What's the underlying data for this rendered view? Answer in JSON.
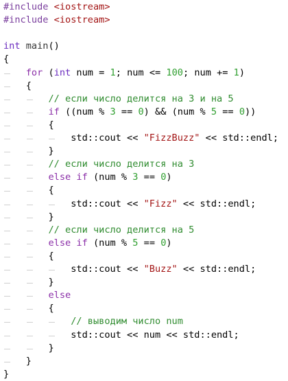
{
  "editor": {
    "lines": [
      [
        [
          "pre",
          "#include"
        ],
        [
          "op",
          " "
        ],
        [
          "inc",
          "<iostream>"
        ]
      ],
      [
        [
          "pre",
          "#include"
        ],
        [
          "op",
          " "
        ],
        [
          "inc",
          "<iostream>"
        ]
      ],
      [],
      [
        [
          "kw2",
          "int"
        ],
        [
          "op",
          " "
        ],
        [
          "fn",
          "main"
        ],
        [
          "op",
          "()"
        ]
      ],
      [
        [
          "op",
          "{"
        ]
      ],
      [
        [
          "op",
          "    "
        ],
        [
          "kw",
          "for"
        ],
        [
          "op",
          " ("
        ],
        [
          "kw2",
          "int"
        ],
        [
          "op",
          " num = "
        ],
        [
          "num",
          "1"
        ],
        [
          "op",
          "; num <= "
        ],
        [
          "num",
          "100"
        ],
        [
          "op",
          "; num += "
        ],
        [
          "num",
          "1"
        ],
        [
          "op",
          ")"
        ]
      ],
      [
        [
          "op",
          "    {"
        ]
      ],
      [
        [
          "op",
          "        "
        ],
        [
          "cm",
          "// если число делится на 3 и на 5"
        ]
      ],
      [
        [
          "op",
          "        "
        ],
        [
          "kw",
          "if"
        ],
        [
          "op",
          " ((num % "
        ],
        [
          "num",
          "3"
        ],
        [
          "op",
          " == "
        ],
        [
          "num",
          "0"
        ],
        [
          "op",
          ") && (num % "
        ],
        [
          "num",
          "5"
        ],
        [
          "op",
          " == "
        ],
        [
          "num",
          "0"
        ],
        [
          "op",
          "))"
        ]
      ],
      [
        [
          "op",
          "        {"
        ]
      ],
      [
        [
          "op",
          "            std::cout << "
        ],
        [
          "str",
          "\"FizzBuzz\""
        ],
        [
          "op",
          " << std::endl;"
        ]
      ],
      [
        [
          "op",
          "        }"
        ]
      ],
      [
        [
          "op",
          "        "
        ],
        [
          "cm",
          "// если число делится на 3"
        ]
      ],
      [
        [
          "op",
          "        "
        ],
        [
          "kw",
          "else"
        ],
        [
          "op",
          " "
        ],
        [
          "kw",
          "if"
        ],
        [
          "op",
          " (num % "
        ],
        [
          "num",
          "3"
        ],
        [
          "op",
          " == "
        ],
        [
          "num",
          "0"
        ],
        [
          "op",
          ")"
        ]
      ],
      [
        [
          "op",
          "        {"
        ]
      ],
      [
        [
          "op",
          "            std::cout << "
        ],
        [
          "str",
          "\"Fizz\""
        ],
        [
          "op",
          " << std::endl;"
        ]
      ],
      [
        [
          "op",
          "        }"
        ]
      ],
      [
        [
          "op",
          "        "
        ],
        [
          "cm",
          "// если число делится на 5"
        ]
      ],
      [
        [
          "op",
          "        "
        ],
        [
          "kw",
          "else"
        ],
        [
          "op",
          " "
        ],
        [
          "kw",
          "if"
        ],
        [
          "op",
          " (num % "
        ],
        [
          "num",
          "5"
        ],
        [
          "op",
          " == "
        ],
        [
          "num",
          "0"
        ],
        [
          "op",
          ")"
        ]
      ],
      [
        [
          "op",
          "        {"
        ]
      ],
      [
        [
          "op",
          "            std::cout << "
        ],
        [
          "str",
          "\"Buzz\""
        ],
        [
          "op",
          " << std::endl;"
        ]
      ],
      [
        [
          "op",
          "        }"
        ]
      ],
      [
        [
          "op",
          "        "
        ],
        [
          "kw",
          "else"
        ]
      ],
      [
        [
          "op",
          "        {"
        ]
      ],
      [
        [
          "op",
          "            "
        ],
        [
          "cm",
          "// выводим число num"
        ]
      ],
      [
        [
          "op",
          "            std::cout << num << std::endl;"
        ]
      ],
      [
        [
          "op",
          "        }"
        ]
      ],
      [
        [
          "op",
          "    }"
        ]
      ],
      [
        [
          "op",
          "}"
        ]
      ]
    ]
  }
}
